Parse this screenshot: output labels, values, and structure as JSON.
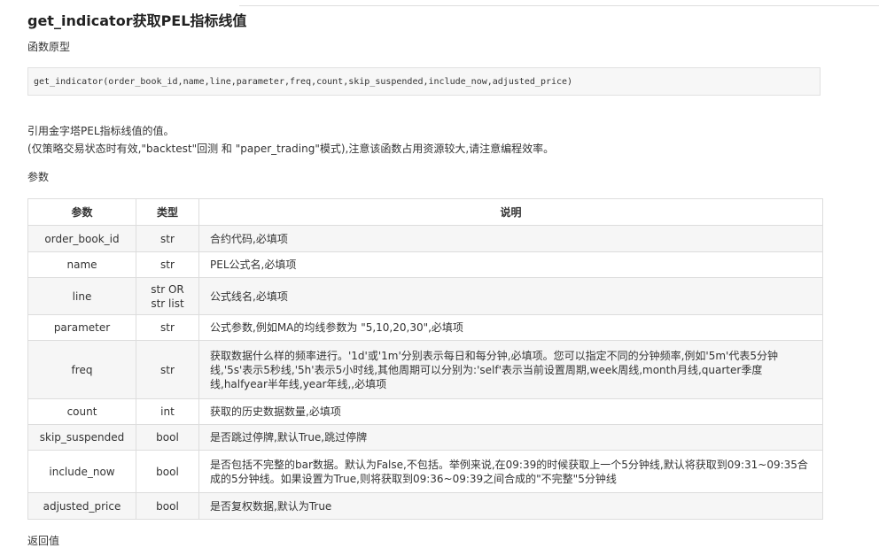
{
  "section_title": "get_indicator获取PEL指标线值",
  "prototype_label": "函数原型",
  "prototype_code": "get_indicator(order_book_id,name,line,parameter,freq,count,skip_suspended,include_now,adjusted_price)",
  "description_line1": "引用金字塔PEL指标线值的值。",
  "description_line2": "(仅策略交易状态时有效,\"backtest\"回测 和 \"paper_trading\"模式),注意该函数占用资源较大,请注意编程效率。",
  "params_label": "参数",
  "table": {
    "headers": [
      "参数",
      "类型",
      "说明"
    ],
    "rows": [
      {
        "name": "order_book_id",
        "type": "str",
        "desc": "合约代码,必填项"
      },
      {
        "name": "name",
        "type": "str",
        "desc": "PEL公式名,必填项"
      },
      {
        "name": "line",
        "type": "str OR\nstr list",
        "desc": "公式线名,必填项"
      },
      {
        "name": "parameter",
        "type": "str",
        "desc": "公式参数,例如MA的均线参数为 \"5,10,20,30\",必填项"
      },
      {
        "name": "freq",
        "type": "str",
        "desc": "获取数据什么样的频率进行。'1d'或'1m'分别表示每日和每分钟,必填项。您可以指定不同的分钟频率,例如'5m'代表5分钟线,'5s'表示5秒线,'5h'表示5小时线,其他周期可以分别为:'self'表示当前设置周期,week周线,month月线,quarter季度线,halfyear半年线,year年线,,必填项"
      },
      {
        "name": "count",
        "type": "int",
        "desc": "获取的历史数据数量,必填项"
      },
      {
        "name": "skip_suspended",
        "type": "bool",
        "desc": "是否跳过停牌,默认True,跳过停牌"
      },
      {
        "name": "include_now",
        "type": "bool",
        "desc": "是否包括不完整的bar数据。默认为False,不包括。举例来说,在09:39的时候获取上一个5分钟线,默认将获取到09:31~09:35合成的5分钟线。如果设置为True,则将获取到09:36~09:39之间合成的\"不完整\"5分钟线"
      },
      {
        "name": "adjusted_price",
        "type": "bool",
        "desc": "是否复权数据,默认为True"
      }
    ]
  },
  "return_label": "返回值"
}
